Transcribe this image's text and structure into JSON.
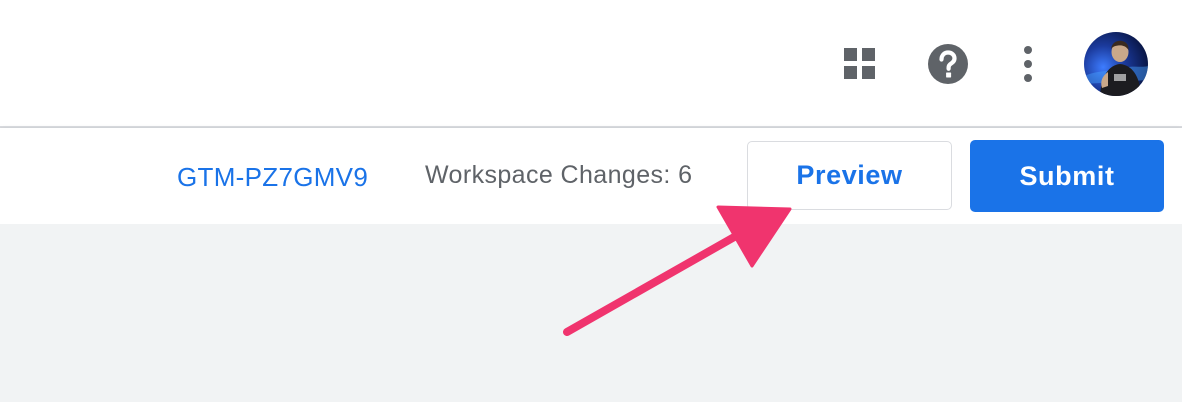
{
  "header": {
    "apps_icon": "apps-grid-icon",
    "help_icon": "help-circle-icon",
    "more_icon": "more-vertical-icon",
    "avatar": "user-avatar"
  },
  "toolbar": {
    "container_id": "GTM-PZ7GMV9",
    "workspace_changes": "Workspace Changes: 6",
    "preview_label": "Preview",
    "submit_label": "Submit"
  },
  "annotation": {
    "type": "arrow",
    "color": "#f0346e",
    "points_to": "preview-button"
  },
  "colors": {
    "accent": "#1a73e8",
    "icon": "#5f6368",
    "background": "#f1f3f4",
    "annotation": "#f0346e"
  }
}
